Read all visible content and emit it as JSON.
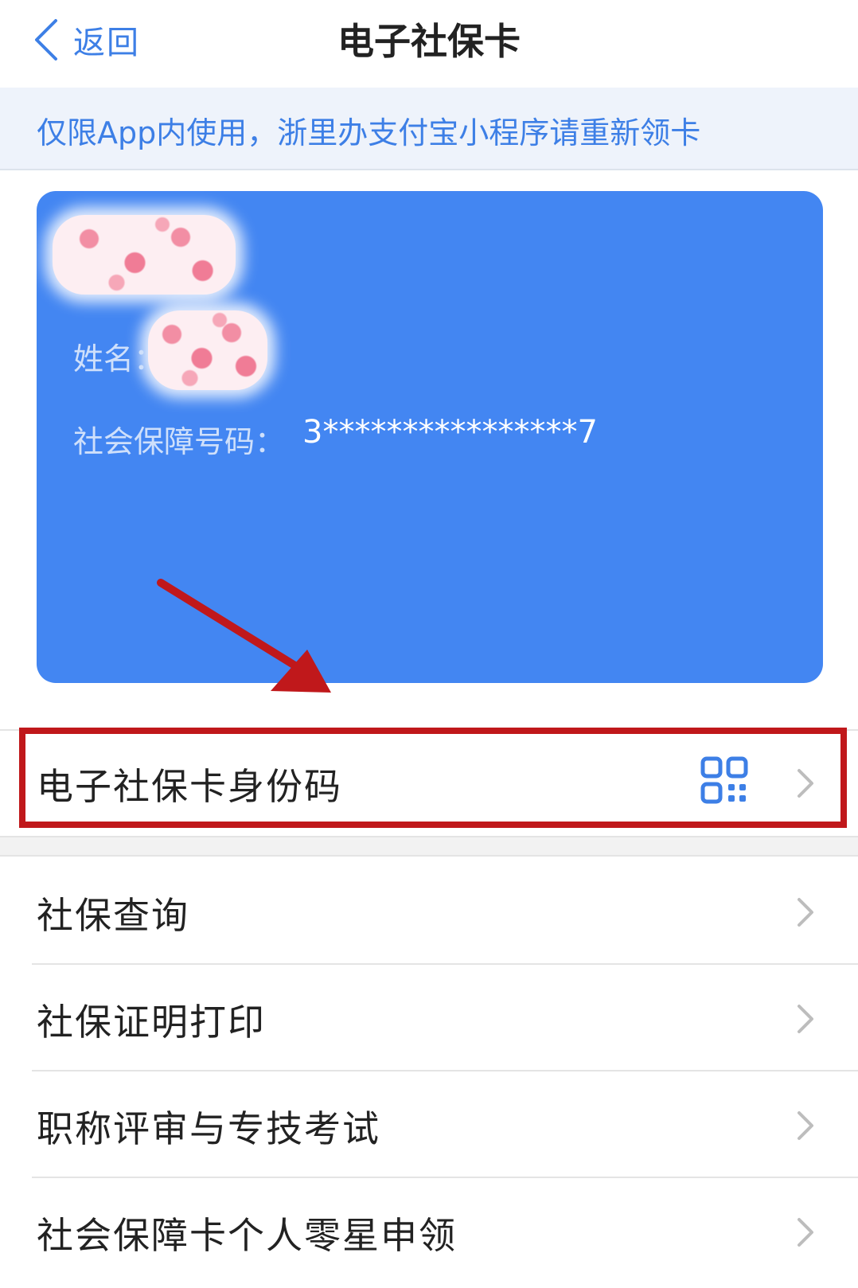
{
  "nav": {
    "back_label": "返回",
    "title": "电子社保卡"
  },
  "notice": {
    "text": "仅限App内使用，浙里办支付宝小程序请重新领卡"
  },
  "card": {
    "name_label": "姓名：",
    "ssn_label": "社会保障号码：",
    "ssn_value": "3****************7",
    "background_color": "#4386f2"
  },
  "menu": {
    "highlighted_item": {
      "label": "电子社保卡身份码",
      "icon": "qr-code-icon"
    },
    "items": [
      {
        "label": "社保查询"
      },
      {
        "label": "社保证明打印"
      },
      {
        "label": "职称评审与专技考试"
      },
      {
        "label": "社会保障卡个人零星申领"
      }
    ]
  },
  "colors": {
    "accent": "#3d7fe6",
    "highlight_border": "#c0181b",
    "arrow": "#c0181b"
  }
}
